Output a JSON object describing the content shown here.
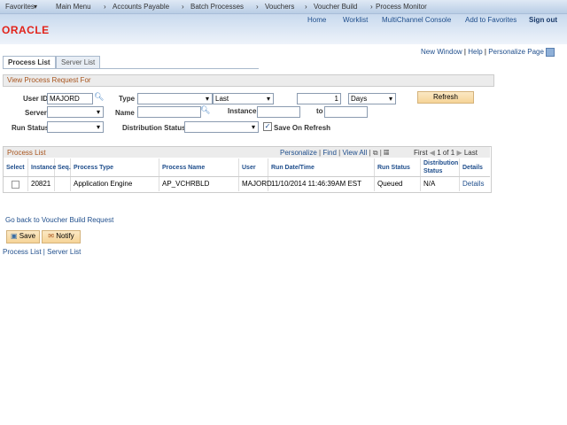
{
  "nav": {
    "favorites": "Favorites",
    "items": [
      "Main Menu",
      "Accounts Payable",
      "Batch Processes",
      "Vouchers",
      "Voucher Build",
      "Process Monitor"
    ]
  },
  "header": {
    "links": [
      "Home",
      "Worklist",
      "MultiChannel Console",
      "Add to Favorites"
    ],
    "signout": "Sign out",
    "logo": "ORACLE"
  },
  "pagebar": {
    "new_window": "New Window",
    "help": "Help",
    "personalize": "Personalize Page"
  },
  "tabs": [
    "Process List",
    "Server List"
  ],
  "filter": {
    "title": "View Process Request For",
    "user_id_label": "User ID",
    "user_id": "MAJORD",
    "type_label": "Type",
    "type": "",
    "last": "Last",
    "count": "1",
    "unit": "Days",
    "refresh": "Refresh",
    "server_label": "Server",
    "server": "",
    "name_label": "Name",
    "name": "",
    "instance_label": "Instance",
    "instance_from": "",
    "to_label": "to",
    "instance_to": "",
    "run_status_label": "Run Status",
    "run_status": "",
    "dist_status_label": "Distribution Status",
    "dist_status": "",
    "save_on_refresh": "Save On Refresh",
    "save_on_refresh_checked": true
  },
  "grid": {
    "title": "Process List",
    "personalize": "Personalize",
    "find": "Find",
    "view_all": "View All",
    "first": "First",
    "pages": "1 of 1",
    "last": "Last",
    "columns": [
      "Select",
      "Instance",
      "Seq.",
      "Process Type",
      "Process Name",
      "User",
      "Run Date/Time",
      "Run Status",
      "Distribution Status",
      "Details"
    ],
    "rows": [
      {
        "instance": "20821",
        "seq": "",
        "process_type": "Application Engine",
        "process_name": "AP_VCHRBLD",
        "user": "MAJORD",
        "run_datetime": "11/10/2014 11:46:39AM EST",
        "run_status": "Queued",
        "dist_status": "N/A",
        "details": "Details"
      }
    ]
  },
  "footer": {
    "go_back": "Go back to Voucher Build Request",
    "save": "Save",
    "notify": "Notify",
    "process_list": "Process List",
    "server_list": "Server List"
  }
}
